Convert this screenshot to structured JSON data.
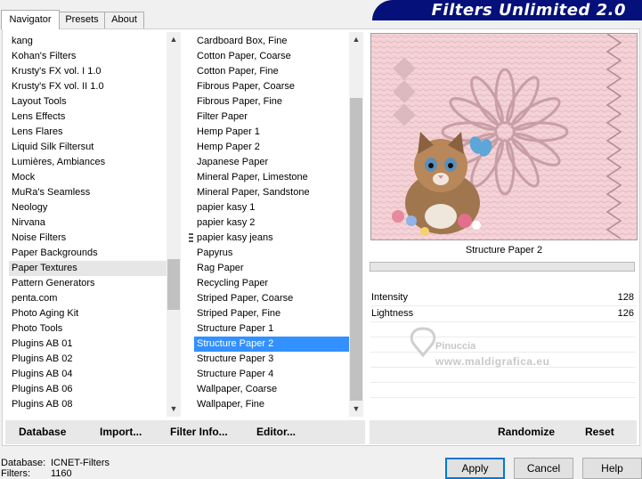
{
  "tabs": [
    "Navigator",
    "Presets",
    "About"
  ],
  "banner_title": "Filters Unlimited 2.0",
  "categories": [
    "kang",
    "Kohan's Filters",
    "Krusty's FX vol. I 1.0",
    "Krusty's FX vol. II 1.0",
    "Layout Tools",
    "Lens Effects",
    "Lens Flares",
    "Liquid Silk Filtersut",
    "Lumières, Ambiances",
    "Mock",
    "MuRa's Seamless",
    "Neology",
    "Nirvana",
    "Noise Filters",
    "Paper Backgrounds",
    "Paper Textures",
    "Pattern Generators",
    "penta.com",
    "Photo Aging Kit",
    "Photo Tools",
    "Plugins AB 01",
    "Plugins AB 02",
    "Plugins AB 04",
    "Plugins AB 06",
    "Plugins AB 08"
  ],
  "selected_category": "Paper Textures",
  "filters": [
    "Cardboard Box, Fine",
    "Cotton Paper, Coarse",
    "Cotton Paper, Fine",
    "Fibrous Paper, Coarse",
    "Fibrous Paper, Fine",
    "Filter Paper",
    "Hemp Paper 1",
    "Hemp Paper 2",
    "Japanese Paper",
    "Mineral Paper, Limestone",
    "Mineral Paper, Sandstone",
    "papier kasy 1",
    "papier kasy 2",
    "papier kasy jeans",
    "Papyrus",
    "Rag Paper",
    "Recycling Paper",
    "Striped Paper, Coarse",
    "Striped Paper, Fine",
    "Structure Paper 1",
    "Structure Paper 2",
    "Structure Paper 3",
    "Structure Paper 4",
    "Wallpaper, Coarse",
    "Wallpaper, Fine"
  ],
  "selected_filter": "Structure Paper 2",
  "preview_label": "Structure Paper 2",
  "parameters": [
    {
      "label": "Intensity",
      "value": "128"
    },
    {
      "label": "Lightness",
      "value": "126"
    }
  ],
  "watermark": {
    "line1": "Pinuccia",
    "line2": "www.maldigrafica.eu"
  },
  "toolbar_left": [
    "Database",
    "Import...",
    "Filter Info...",
    "Editor..."
  ],
  "toolbar_right": [
    "Randomize",
    "Reset"
  ],
  "status": {
    "db_label": "Database:",
    "db_value": "ICNET-Filters",
    "filters_label": "Filters:",
    "filters_value": "1160"
  },
  "buttons": {
    "apply": "Apply",
    "cancel": "Cancel",
    "help": "Help"
  },
  "colors": {
    "banner": "#05107a",
    "selection_blue": "#3390ff",
    "selection_grey": "#e6e6e6",
    "preview_pink": "#f4d2d6"
  }
}
